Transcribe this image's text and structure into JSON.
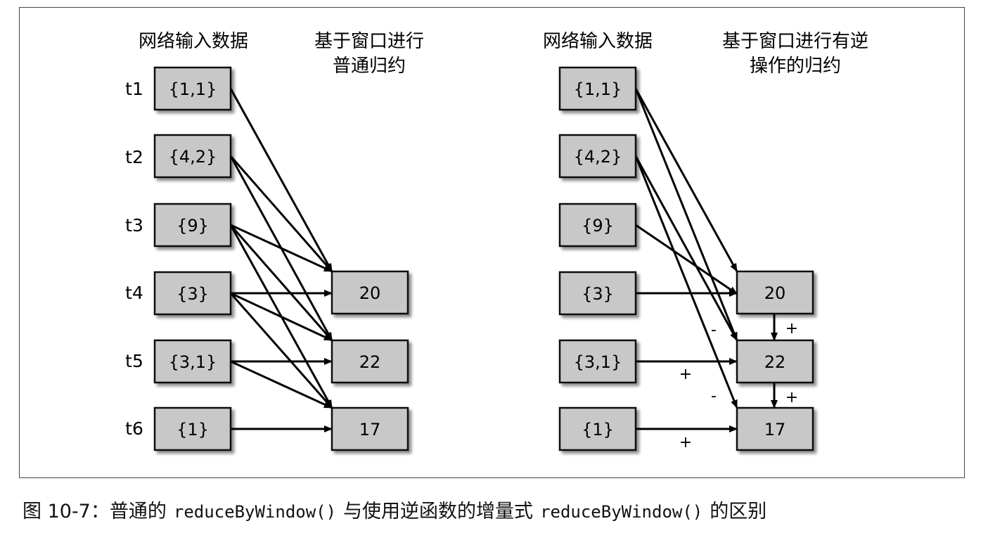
{
  "left": {
    "input_header": "网络输入数据",
    "output_header": [
      "基于窗口进行",
      "普通归约"
    ],
    "time_labels": [
      "t1",
      "t2",
      "t3",
      "t4",
      "t5",
      "t6"
    ],
    "inputs": [
      "{1,1}",
      "{4,2}",
      "{9}",
      "{3}",
      "{3,1}",
      "{1}"
    ],
    "outputs": [
      "20",
      "22",
      "17"
    ]
  },
  "right": {
    "input_header": "网络输入数据",
    "output_header": [
      "基于窗口进行有逆",
      "操作的归约"
    ],
    "inputs": [
      "{1,1}",
      "{4,2}",
      "{9}",
      "{3}",
      "{3,1}",
      "{1}"
    ],
    "outputs": [
      "20",
      "22",
      "17"
    ],
    "signs": {
      "plus_20_22": "+",
      "plus_22_17": "+",
      "minus_a": "-",
      "minus_b": "-",
      "plus_t5": "+",
      "plus_t6": "+"
    }
  },
  "caption": {
    "prefix": "图 10-7：普通的",
    "code1": "reduceByWindow()",
    "middle": "与使用逆函数的增量式",
    "code2": "reduceByWindow()",
    "suffix": "的区别"
  },
  "colors": {
    "box_fill": "#c8c8c8",
    "box_stroke": "#111111",
    "arrow": "#000000"
  }
}
